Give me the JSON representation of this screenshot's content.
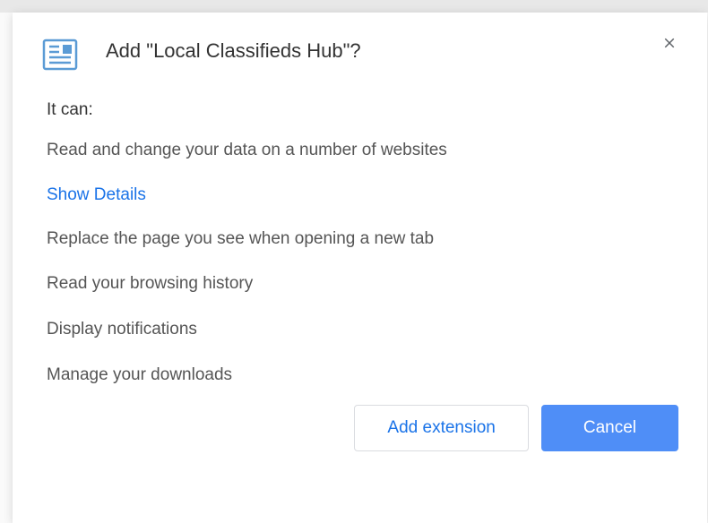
{
  "dialog": {
    "title": "Add \"Local Classifieds Hub\"?",
    "intro": "It can:",
    "permissions": [
      "Read and change your data on a number of websites",
      "Replace the page you see when opening a new tab",
      "Read your browsing history",
      "Display notifications",
      "Manage your downloads"
    ],
    "show_details_label": "Show Details",
    "add_button_label": "Add extension",
    "cancel_button_label": "Cancel"
  }
}
